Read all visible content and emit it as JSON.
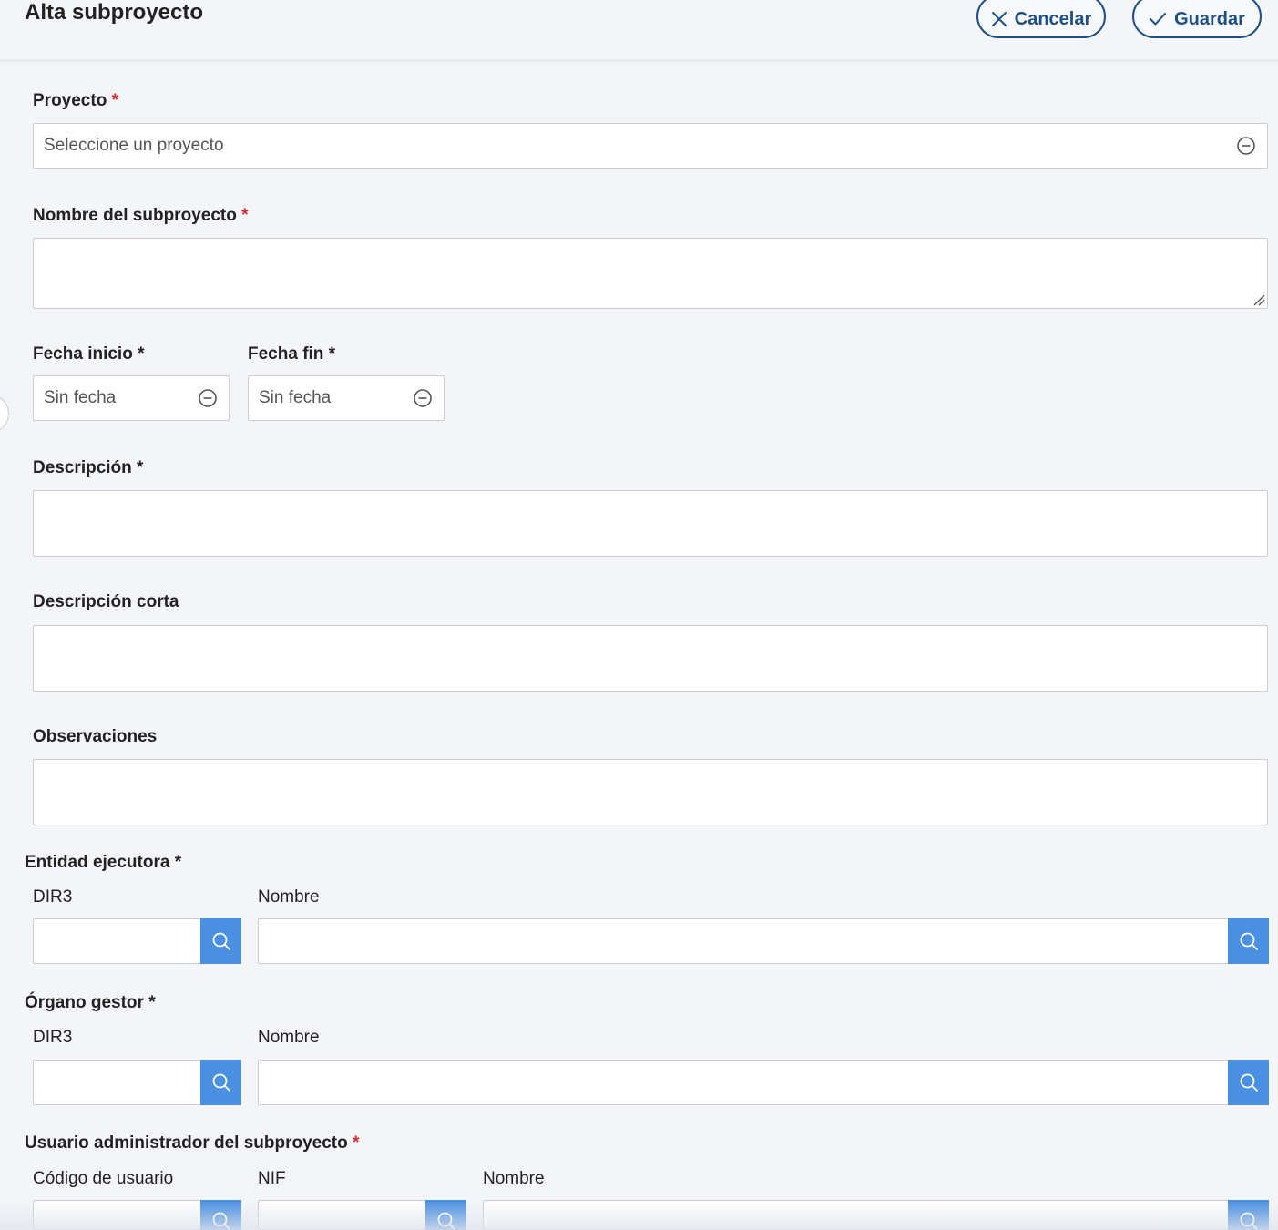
{
  "header": {
    "title": "Alta subproyecto",
    "cancel_label": "Cancelar",
    "save_label": "Guardar"
  },
  "form": {
    "proyecto": {
      "label": "Proyecto",
      "required_mark": "*",
      "placeholder": "Seleccione un proyecto"
    },
    "nombre_subproyecto": {
      "label": "Nombre del subproyecto",
      "required_mark": "*",
      "value": ""
    },
    "fecha_inicio": {
      "label": "Fecha inicio",
      "required_mark": "*",
      "placeholder": "Sin fecha"
    },
    "fecha_fin": {
      "label": "Fecha fin",
      "required_mark": "*",
      "placeholder": "Sin fecha"
    },
    "descripcion": {
      "label": "Descripción",
      "required_mark": "*",
      "value": ""
    },
    "descripcion_corta": {
      "label": "Descripción corta",
      "value": ""
    },
    "observaciones": {
      "label": "Observaciones",
      "value": ""
    },
    "entidad_ejecutora": {
      "label": "Entidad ejecutora",
      "required_mark": "*",
      "dir3_label": "DIR3",
      "nombre_label": "Nombre",
      "dir3_value": "",
      "nombre_value": ""
    },
    "organo_gestor": {
      "label": "Órgano gestor",
      "required_mark": "*",
      "dir3_label": "DIR3",
      "nombre_label": "Nombre",
      "dir3_value": "",
      "nombre_value": ""
    },
    "usuario_admin": {
      "label": "Usuario administrador del subproyecto",
      "required_mark": "*",
      "codigo_label": "Código de usuario",
      "nif_label": "NIF",
      "nombre_label": "Nombre",
      "codigo_value": "",
      "nif_value": "",
      "nombre_value": ""
    }
  },
  "colors": {
    "accent": "#1e4f86",
    "search_button": "#4a90e2",
    "required_red": "#d9262b",
    "background": "#f3f5f9"
  },
  "icons": {
    "cancel": "close-icon",
    "save": "check-icon",
    "clear": "minus-circle-icon",
    "search": "search-icon",
    "resize": "resize-handle-icon"
  }
}
